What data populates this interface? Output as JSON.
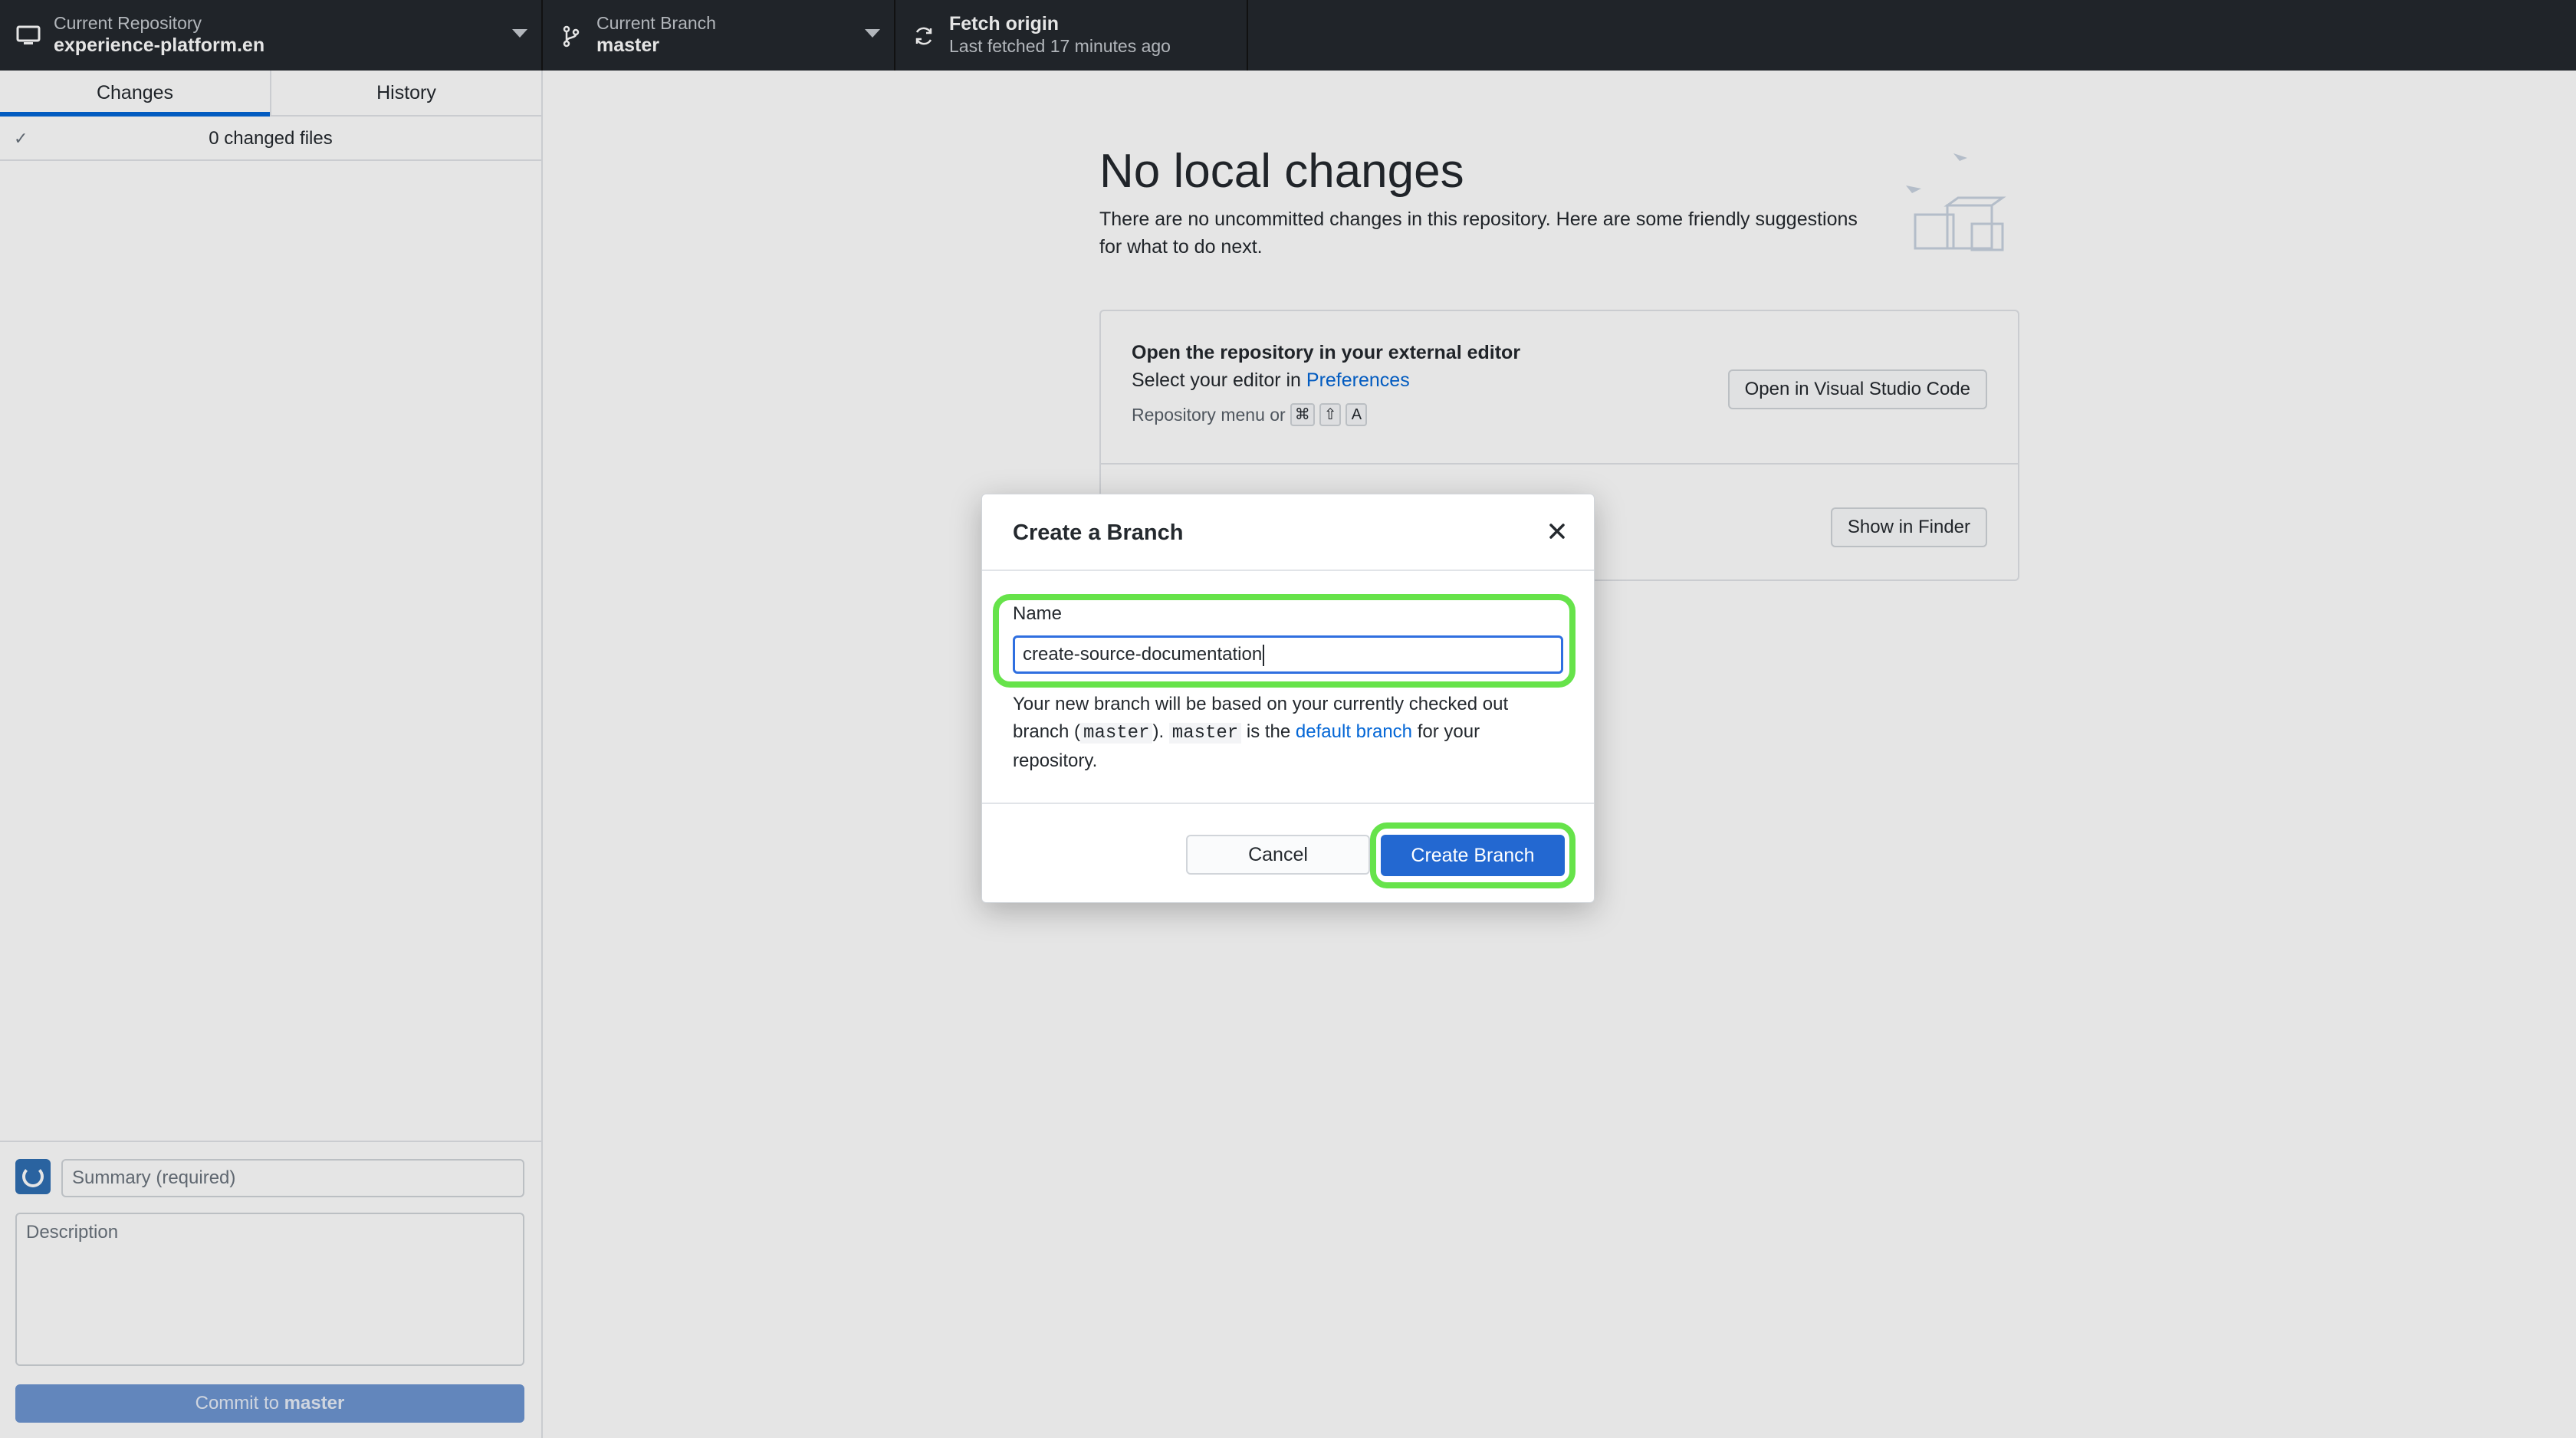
{
  "topbar": {
    "repo": {
      "label": "Current Repository",
      "value": "experience-platform.en"
    },
    "branch": {
      "label": "Current Branch",
      "value": "master"
    },
    "fetch": {
      "label": "Fetch origin",
      "value": "Last fetched 17 minutes ago"
    }
  },
  "sidebar": {
    "tabs": [
      {
        "label": "Changes",
        "active": true
      },
      {
        "label": "History",
        "active": false
      }
    ],
    "changed_files": "0 changed files",
    "summary_placeholder": "Summary (required)",
    "description_placeholder": "Description",
    "commit_prefix": "Commit to",
    "commit_branch": "master"
  },
  "main": {
    "title": "No local changes",
    "subtitle": "There are no uncommitted changes in this repository. Here are some friendly suggestions for what to do next.",
    "editor_card": {
      "title": "Open the repository in your external editor",
      "line2_prefix": "Select your editor in",
      "line2_link": "Preferences",
      "shortcut_prefix": "Repository menu or",
      "keys": [
        "⌘",
        "⇧",
        "A"
      ],
      "button": "Open in Visual Studio Code"
    },
    "finder_button": "Show in Finder"
  },
  "dialog": {
    "title": "Create a Branch",
    "name_label": "Name",
    "name_value": "create-source-documentation",
    "note": {
      "p1": "Your new branch will be based on your currently checked out branch (",
      "code1": "master",
      "p2": "). ",
      "code2": "master",
      "p3": " is the ",
      "link": "default branch",
      "p4": " for your repository."
    },
    "cancel": "Cancel",
    "create": "Create Branch"
  },
  "colors": {
    "topbar": "#24292e",
    "accent": "#0366d6",
    "primary_button": "#2368d1",
    "highlight": "#66e34a"
  }
}
